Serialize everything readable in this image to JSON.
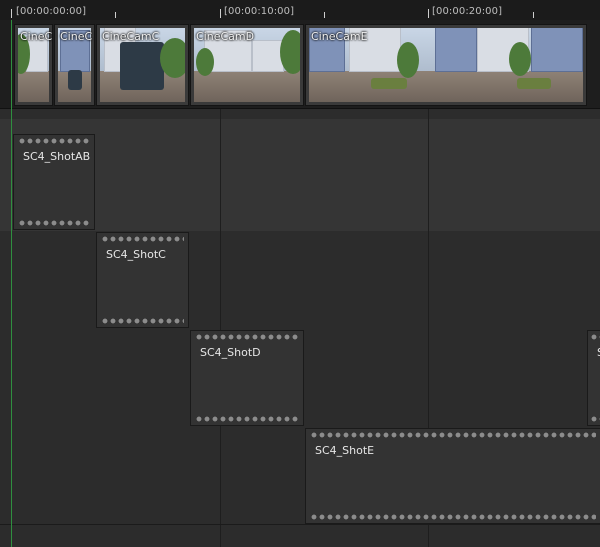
{
  "ruler": {
    "labels": [
      "[00:00:00:00]",
      "[00:00:10:00]",
      "[00:00:20:00]"
    ]
  },
  "cameras": [
    {
      "name": "CineC"
    },
    {
      "name": "CineC"
    },
    {
      "name": "CineCamC"
    },
    {
      "name": "CineCamD"
    },
    {
      "name": "CineCamE"
    }
  ],
  "shots": [
    {
      "name": "SC4_ShotAB"
    },
    {
      "name": "SC4_ShotC"
    },
    {
      "name": "SC4_ShotD"
    },
    {
      "name": "SC4_ShotE"
    },
    {
      "name": "S"
    }
  ],
  "colors": {
    "playhead": "#2f8f3f",
    "track_bg": "#2c2c2c",
    "section_bg": "#333333"
  }
}
